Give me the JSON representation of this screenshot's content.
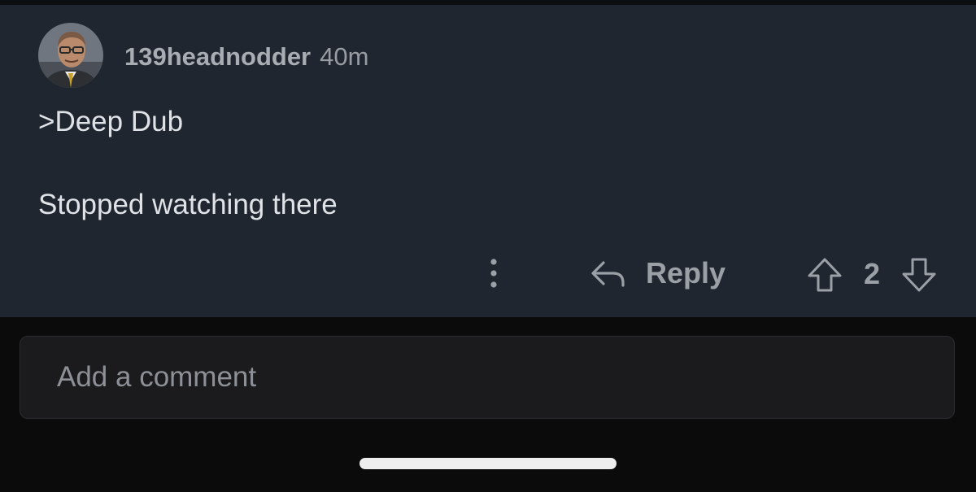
{
  "comment": {
    "author": "139headnodder",
    "timestamp": "40m",
    "lines": [
      ">Deep Dub",
      "Stopped watching there"
    ],
    "avatar_icon": "user-avatar-icon"
  },
  "actions": {
    "more_icon": "vertical-ellipsis-icon",
    "reply_icon": "reply-arrow-icon",
    "reply_label": "Reply",
    "upvote_icon": "arrow-up-icon",
    "vote_count": "2",
    "downvote_icon": "arrow-down-icon"
  },
  "composer": {
    "placeholder": "Add a comment"
  },
  "colors": {
    "card_background": "#202630",
    "page_background": "#0b0b0c",
    "input_background": "#1b1b1d",
    "comment_text": "#dfe2e6",
    "muted_text": "#9aa0a6",
    "home_indicator": "#eeeeee"
  }
}
